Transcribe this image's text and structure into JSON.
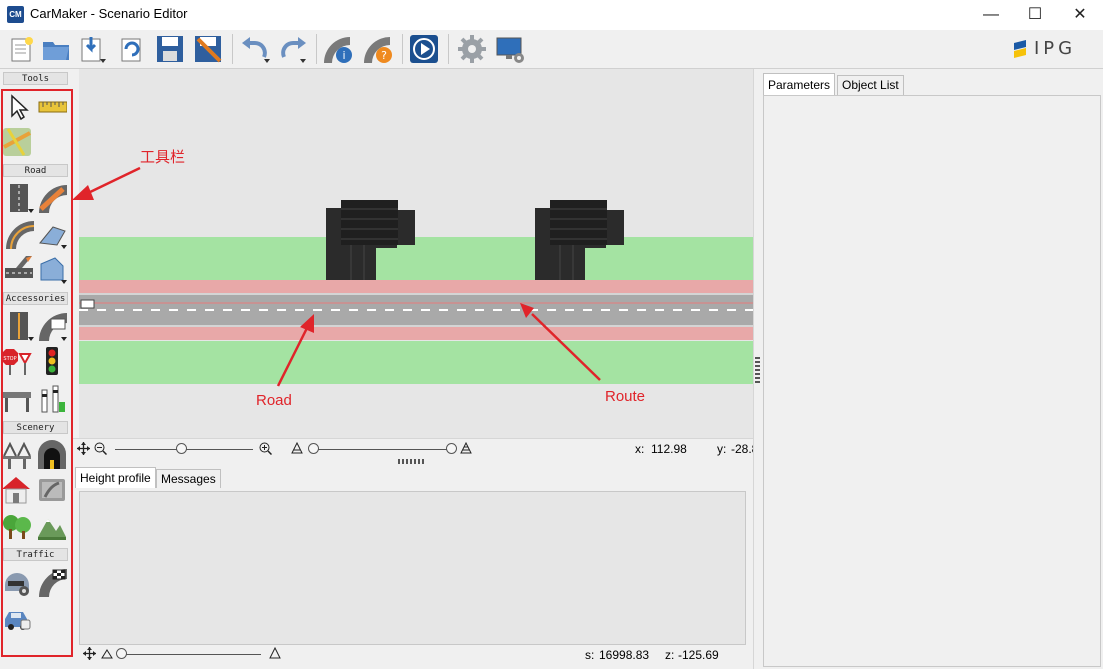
{
  "window": {
    "icon_text": "CM",
    "title": "CarMaker - Scenario Editor",
    "minimize": "—",
    "maximize": "☐",
    "close": "✕"
  },
  "toolbar": {
    "items": [
      "new-file-icon",
      "open-folder-icon",
      "import-icon",
      "reload-icon",
      "save-icon",
      "save-as-icon",
      "undo-icon",
      "redo-icon",
      "road-info-icon",
      "road-help-icon",
      "play-icon",
      "settings-gear-icon",
      "monitor-settings-icon"
    ],
    "logo_text": "IPG"
  },
  "palette": {
    "tools_label": "Tools",
    "road_label": "Road",
    "accessories_label": "Accessories",
    "scenery_label": "Scenery",
    "traffic_label": "Traffic"
  },
  "canvas": {
    "coord_x_label": "x:",
    "coord_x_value": "112.98",
    "coord_y_label": "y:",
    "coord_y_value": "-28.8"
  },
  "bottom_tabs": {
    "height_profile": "Height profile",
    "messages": "Messages"
  },
  "bottom_status": {
    "s_label": "s:",
    "s_value": "16998.83",
    "z_label": "z:",
    "z_value": "-125.69"
  },
  "right_tabs": {
    "parameters": "Parameters",
    "object_list": "Object List"
  },
  "annotations": {
    "toolbar_label": "工具栏",
    "road_label": "Road",
    "route_label": "Route"
  },
  "colors": {
    "annotation_red": "#e0242a",
    "grass_green": "#a4e3a2",
    "sidewalk_pink": "#e8a8a8",
    "road_gray": "#a9a9a9"
  }
}
